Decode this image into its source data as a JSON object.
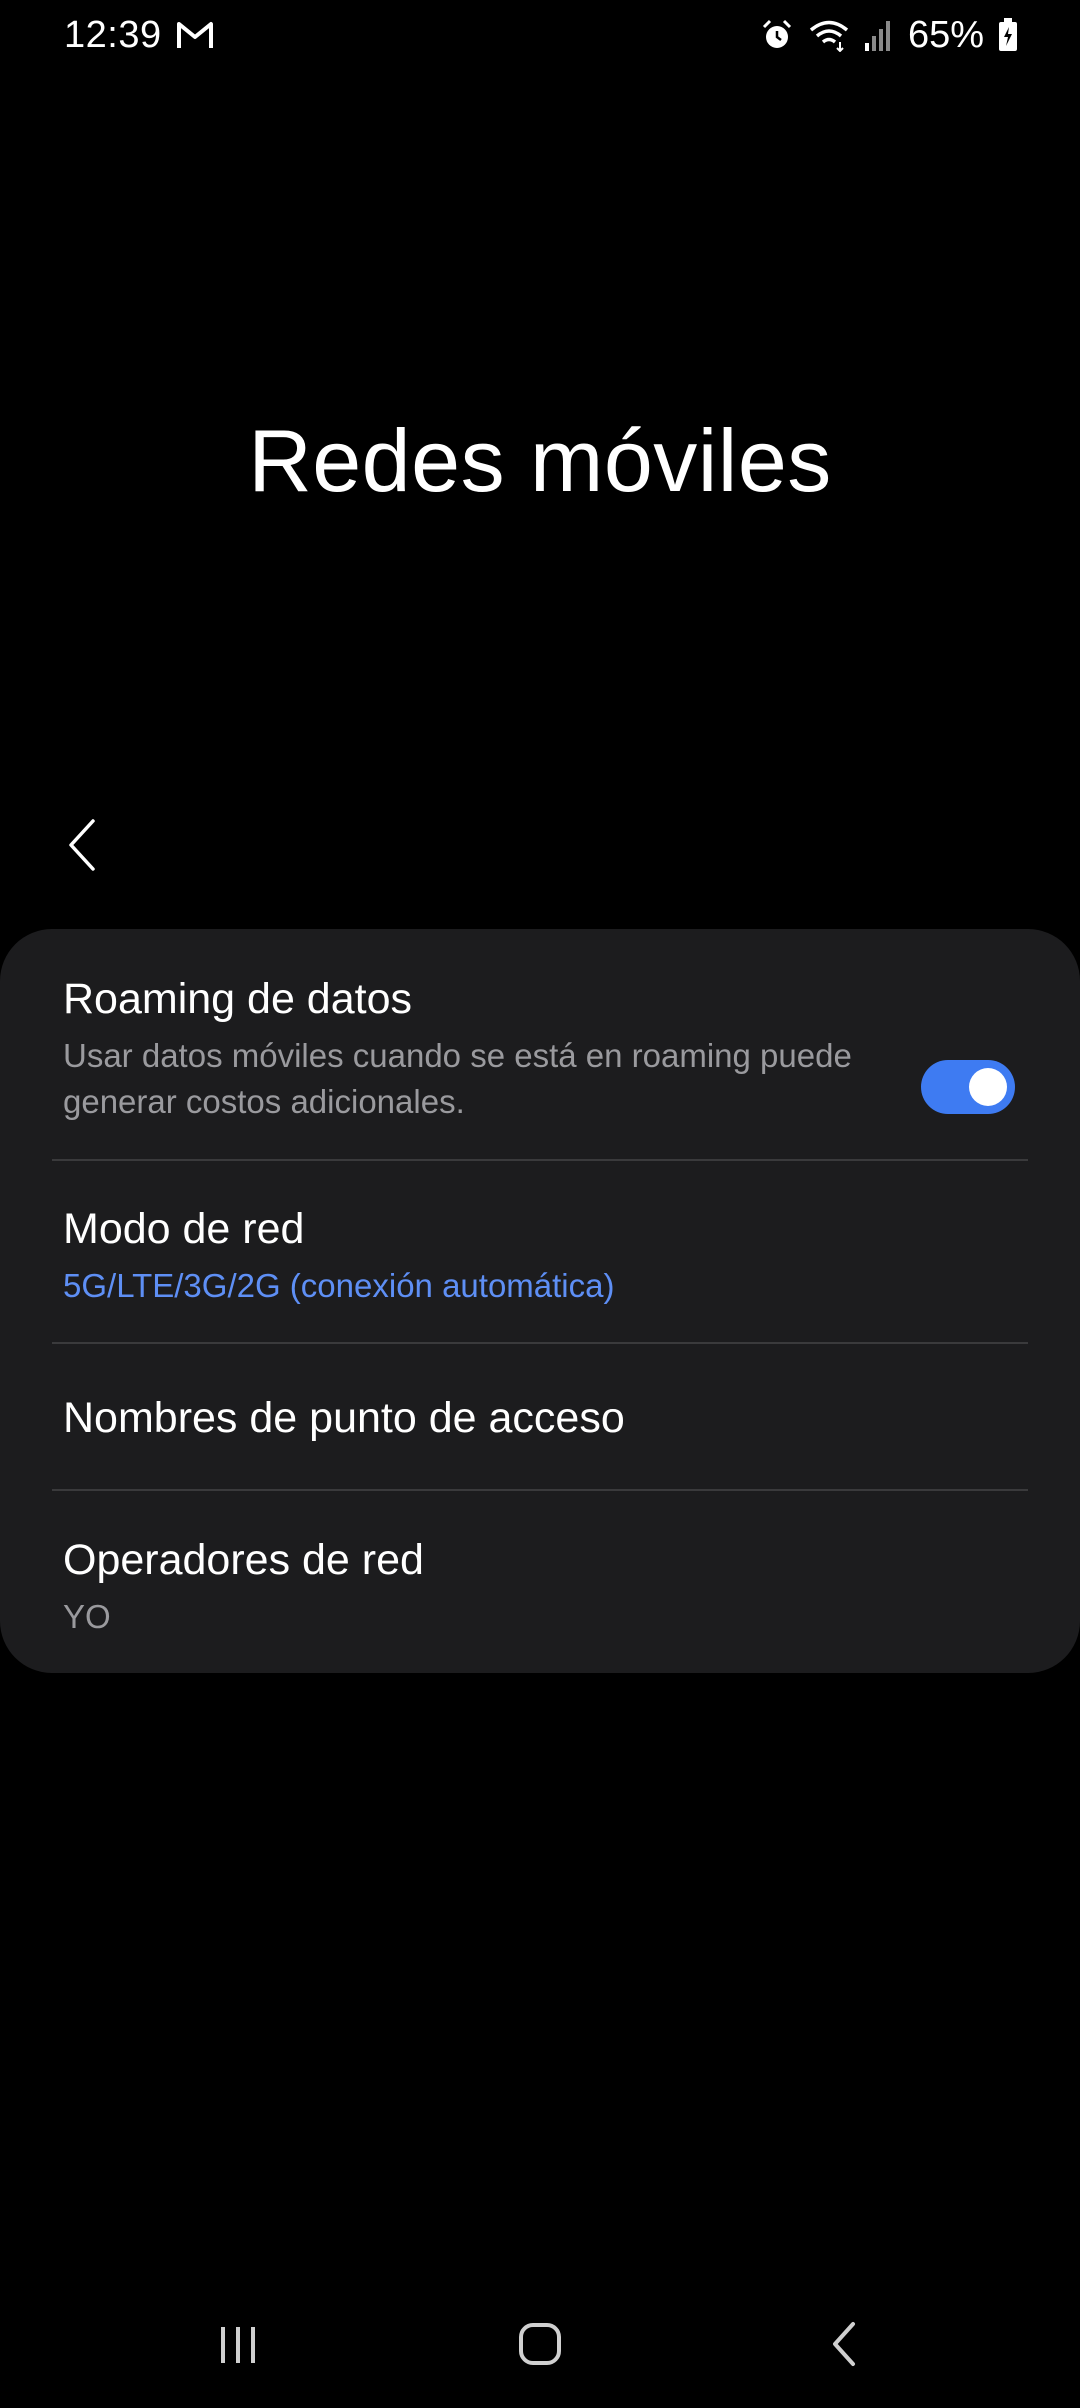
{
  "status_bar": {
    "time": "12:39",
    "battery": "65%",
    "icons": [
      "gmail-icon",
      "alarm-icon",
      "wifi-icon",
      "signal-icon",
      "battery-charging-icon"
    ]
  },
  "page": {
    "title": "Redes móviles"
  },
  "settings": {
    "roaming": {
      "title": "Roaming de datos",
      "subtitle": "Usar datos móviles cuando se está en roaming puede generar costos adicionales.",
      "enabled": true
    },
    "network_mode": {
      "title": "Modo de red",
      "value": "5G/LTE/3G/2G (conexión automática)"
    },
    "apn": {
      "title": "Nombres de punto de acceso"
    },
    "operators": {
      "title": "Operadores de red",
      "value": "YO"
    }
  },
  "colors": {
    "accent": "#3e7bf2",
    "link_blue": "#5e8ff5",
    "card_bg": "#1c1c1e",
    "background": "#000000"
  }
}
